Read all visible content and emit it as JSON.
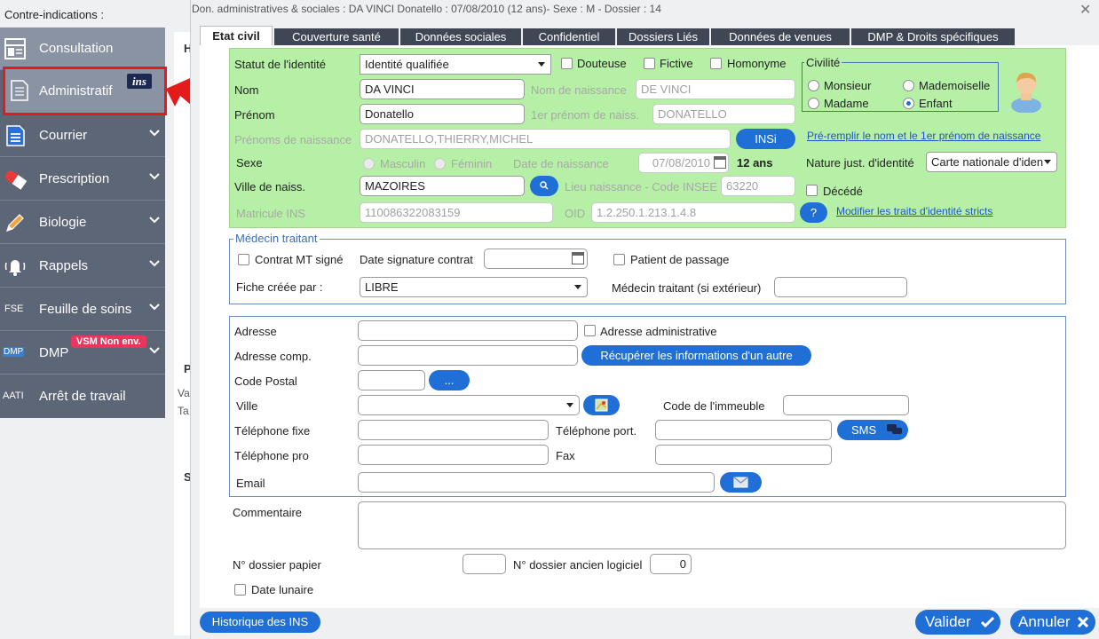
{
  "sidebar": {
    "header": "Contre-indications :",
    "items": [
      {
        "label": "Consultation",
        "icon": "consultation-icon"
      },
      {
        "label": "Administratif",
        "icon": "document-icon",
        "badge": "ins"
      },
      {
        "label": "Courrier",
        "icon": "letter-icon"
      },
      {
        "label": "Prescription",
        "icon": "pill-icon"
      },
      {
        "label": "Biologie",
        "icon": "pencil-icon"
      },
      {
        "label": "Rappels",
        "icon": "bell-icon"
      },
      {
        "label": "Feuille de soins",
        "icon": "fse-icon",
        "icon_text": "FSE"
      },
      {
        "label": "DMP",
        "icon": "dmp-icon",
        "icon_text": "DMP",
        "badge": "VSM Non env."
      },
      {
        "label": "Arrêt de travail",
        "icon": "aati-icon",
        "icon_text": "AATI"
      }
    ],
    "behind_letters": [
      "H",
      "P",
      "Va",
      "Ta",
      "S"
    ]
  },
  "dialog": {
    "title": "Don. administratives & sociales : DA VINCI Donatello : 07/08/2010 (12 ans)- Sexe : M - Dossier : 14",
    "close": "✕",
    "tabs": [
      "Etat civil",
      "Couverture santé",
      "Données sociales",
      "Confidentiel",
      "Dossiers Liés",
      "Données de venues",
      "DMP & Droits spécifiques"
    ]
  },
  "etat_civil": {
    "statut_label": "Statut de l'identité",
    "statut_value": "Identité qualifiée",
    "douteuse": "Douteuse",
    "fictive": "Fictive",
    "homonyme": "Homonyme",
    "civilite": {
      "legend": "Civilité",
      "options": [
        "Monsieur",
        "Mademoiselle",
        "Madame",
        "Enfant"
      ],
      "selected": "Enfant"
    },
    "nom_label": "Nom",
    "nom_value": "DA VINCI",
    "nom_naissance_label": "Nom de naissance",
    "nom_naissance_value": "DE VINCI",
    "prenom_label": "Prénom",
    "prenom_value": "Donatello",
    "prenom_naiss_label": "1er prénom de naiss.",
    "prenom_naiss_value": "DONATELLO",
    "prenoms_naissance_label": "Prénoms de naissance",
    "prenoms_naissance_value": "DONATELLO,THIERRY,MICHEL",
    "insi_button": "INSi",
    "pre_remplir_link": "Pré-remplir le nom et le 1er prénom de naissance",
    "sexe_label": "Sexe",
    "masculin": "Masculin",
    "feminin": "Féminin",
    "date_naissance_label": "Date de naissance",
    "date_naissance_value": "07/08/2010",
    "age": "12 ans",
    "nature_label": "Nature just. d'identité",
    "nature_value": "Carte nationale d'iden",
    "ville_naiss_label": "Ville de naiss.",
    "ville_naiss_value": "MAZOIRES",
    "lieu_naiss_label": "Lieu naissance - Code INSEE",
    "lieu_naiss_value": "63220",
    "decede": "Décédé",
    "matricule_label": "Matricule INS",
    "matricule_value": "110086322083159",
    "oid_label": "OID",
    "oid_value": "1.2.250.1.213.1.4.8",
    "help": "?",
    "modifier_link": "Modifier les traits d'identité stricts"
  },
  "medecin": {
    "legend": "Médecin traitant",
    "contrat": "Contrat MT signé",
    "date_signature": "Date signature contrat",
    "patient_passage": "Patient de passage",
    "fiche_label": "Fiche créée par :",
    "fiche_value": "LIBRE",
    "medecin_ext_label": "Médecin traitant (si extérieur)"
  },
  "adresse": {
    "adresse_label": "Adresse",
    "adresse_admin": "Adresse administrative",
    "adresse_comp_label": "Adresse comp.",
    "recuperer_button": "Récupérer les informations d'un autre",
    "code_postal_label": "Code Postal",
    "cp_button": "...",
    "ville_label": "Ville",
    "code_immeuble_label": "Code de l'immeuble",
    "tel_fixe_label": "Téléphone fixe",
    "tel_port_label": "Téléphone port.",
    "sms_button": "SMS",
    "tel_pro_label": "Téléphone pro",
    "fax_label": "Fax",
    "email_label": "Email"
  },
  "misc": {
    "commentaire_label": "Commentaire",
    "dossier_papier_label": "N° dossier papier",
    "dossier_ancien_label": "N° dossier ancien logiciel",
    "dossier_ancien_value": "0",
    "date_lunaire": "Date lunaire"
  },
  "footer": {
    "historique": "Historique des INS",
    "valider": "Valider",
    "annuler": "Annuler"
  },
  "colors": {
    "sidebar": "#5d6677",
    "accent": "#1f6fd6",
    "etat_civil_bg": "#b6f0a6",
    "highlight": "#e31b1b"
  }
}
